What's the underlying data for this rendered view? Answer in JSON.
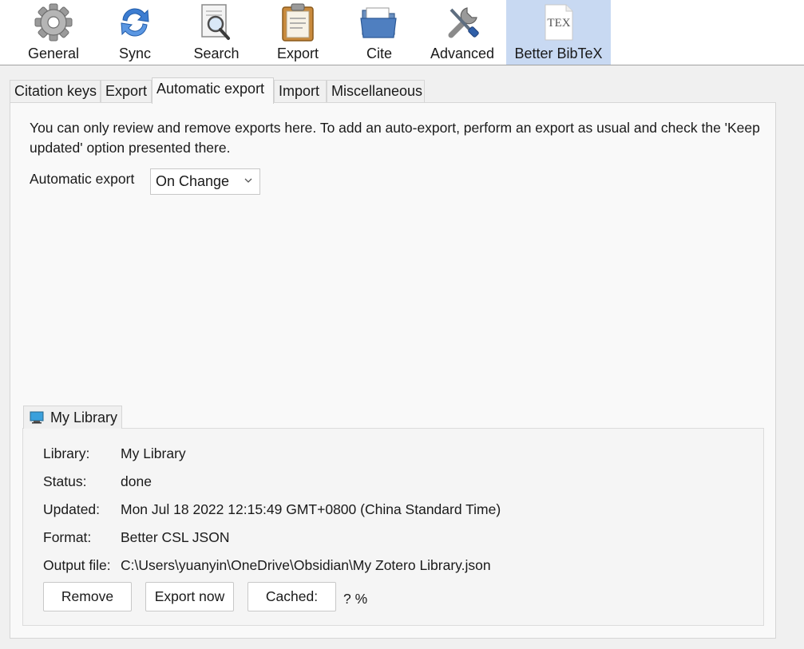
{
  "toolbar": {
    "items": [
      {
        "label": "General",
        "icon": "gear-icon"
      },
      {
        "label": "Sync",
        "icon": "sync-icon"
      },
      {
        "label": "Search",
        "icon": "search-icon"
      },
      {
        "label": "Export",
        "icon": "clipboard-icon"
      },
      {
        "label": "Cite",
        "icon": "folder-icon"
      },
      {
        "label": "Advanced",
        "icon": "tools-icon"
      },
      {
        "label": "Better BibTeX",
        "icon": "tex-icon",
        "active": true
      }
    ],
    "tex_logo_text": "TEX"
  },
  "tabs": [
    {
      "label": "Citation keys"
    },
    {
      "label": "Export"
    },
    {
      "label": "Automatic export",
      "active": true
    },
    {
      "label": "Import"
    },
    {
      "label": "Miscellaneous"
    }
  ],
  "auto_export": {
    "description": "You can only review and remove exports here. To add an auto-export, perform an export as usual and check the 'Keep updated' option presented there.",
    "label": "Automatic export",
    "selected": "On Change"
  },
  "library": {
    "tab_label": "My Library",
    "fields": {
      "library_key": "Library:",
      "library_val": "My Library",
      "status_key": "Status:",
      "status_val": "done",
      "updated_key": "Updated:",
      "updated_val": "Mon Jul 18 2022 12:15:49 GMT+0800 (China Standard Time)",
      "format_key": "Format:",
      "format_val": "Better CSL JSON",
      "output_key": "Output file:",
      "output_val": "C:\\Users\\yuanyin\\OneDrive\\Obsidian\\My Zotero Library.json"
    },
    "buttons": {
      "remove": "Remove",
      "export_now": "Export now",
      "cached": "Cached:"
    },
    "cached_pct": "? %"
  },
  "colors": {
    "active_tab_bg": "#c8d9f2",
    "panel_bg": "#f9f9f9",
    "window_bg": "#f0f0f0"
  }
}
